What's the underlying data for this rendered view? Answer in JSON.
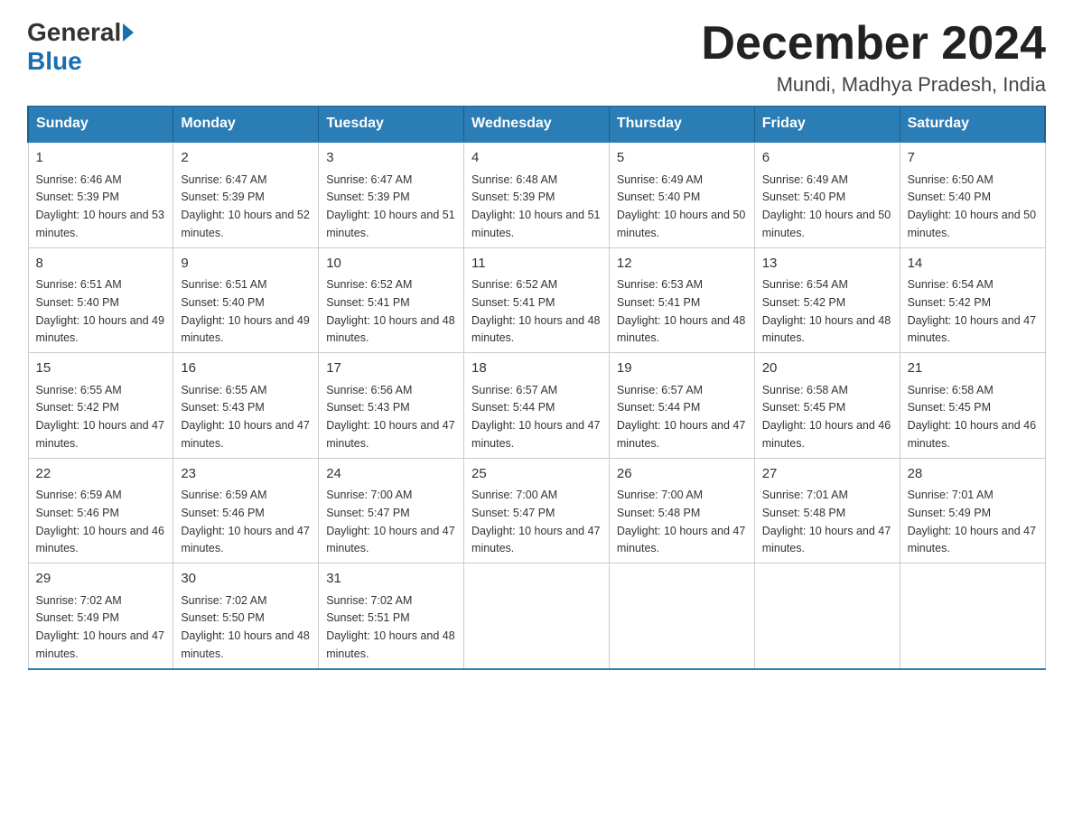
{
  "header": {
    "logo": {
      "general": "General",
      "blue": "Blue"
    },
    "title": "December 2024",
    "location": "Mundi, Madhya Pradesh, India"
  },
  "days_of_week": [
    "Sunday",
    "Monday",
    "Tuesday",
    "Wednesday",
    "Thursday",
    "Friday",
    "Saturday"
  ],
  "weeks": [
    [
      {
        "day": "1",
        "sunrise": "6:46 AM",
        "sunset": "5:39 PM",
        "daylight": "10 hours and 53 minutes."
      },
      {
        "day": "2",
        "sunrise": "6:47 AM",
        "sunset": "5:39 PM",
        "daylight": "10 hours and 52 minutes."
      },
      {
        "day": "3",
        "sunrise": "6:47 AM",
        "sunset": "5:39 PM",
        "daylight": "10 hours and 51 minutes."
      },
      {
        "day": "4",
        "sunrise": "6:48 AM",
        "sunset": "5:39 PM",
        "daylight": "10 hours and 51 minutes."
      },
      {
        "day": "5",
        "sunrise": "6:49 AM",
        "sunset": "5:40 PM",
        "daylight": "10 hours and 50 minutes."
      },
      {
        "day": "6",
        "sunrise": "6:49 AM",
        "sunset": "5:40 PM",
        "daylight": "10 hours and 50 minutes."
      },
      {
        "day": "7",
        "sunrise": "6:50 AM",
        "sunset": "5:40 PM",
        "daylight": "10 hours and 50 minutes."
      }
    ],
    [
      {
        "day": "8",
        "sunrise": "6:51 AM",
        "sunset": "5:40 PM",
        "daylight": "10 hours and 49 minutes."
      },
      {
        "day": "9",
        "sunrise": "6:51 AM",
        "sunset": "5:40 PM",
        "daylight": "10 hours and 49 minutes."
      },
      {
        "day": "10",
        "sunrise": "6:52 AM",
        "sunset": "5:41 PM",
        "daylight": "10 hours and 48 minutes."
      },
      {
        "day": "11",
        "sunrise": "6:52 AM",
        "sunset": "5:41 PM",
        "daylight": "10 hours and 48 minutes."
      },
      {
        "day": "12",
        "sunrise": "6:53 AM",
        "sunset": "5:41 PM",
        "daylight": "10 hours and 48 minutes."
      },
      {
        "day": "13",
        "sunrise": "6:54 AM",
        "sunset": "5:42 PM",
        "daylight": "10 hours and 48 minutes."
      },
      {
        "day": "14",
        "sunrise": "6:54 AM",
        "sunset": "5:42 PM",
        "daylight": "10 hours and 47 minutes."
      }
    ],
    [
      {
        "day": "15",
        "sunrise": "6:55 AM",
        "sunset": "5:42 PM",
        "daylight": "10 hours and 47 minutes."
      },
      {
        "day": "16",
        "sunrise": "6:55 AM",
        "sunset": "5:43 PM",
        "daylight": "10 hours and 47 minutes."
      },
      {
        "day": "17",
        "sunrise": "6:56 AM",
        "sunset": "5:43 PM",
        "daylight": "10 hours and 47 minutes."
      },
      {
        "day": "18",
        "sunrise": "6:57 AM",
        "sunset": "5:44 PM",
        "daylight": "10 hours and 47 minutes."
      },
      {
        "day": "19",
        "sunrise": "6:57 AM",
        "sunset": "5:44 PM",
        "daylight": "10 hours and 47 minutes."
      },
      {
        "day": "20",
        "sunrise": "6:58 AM",
        "sunset": "5:45 PM",
        "daylight": "10 hours and 46 minutes."
      },
      {
        "day": "21",
        "sunrise": "6:58 AM",
        "sunset": "5:45 PM",
        "daylight": "10 hours and 46 minutes."
      }
    ],
    [
      {
        "day": "22",
        "sunrise": "6:59 AM",
        "sunset": "5:46 PM",
        "daylight": "10 hours and 46 minutes."
      },
      {
        "day": "23",
        "sunrise": "6:59 AM",
        "sunset": "5:46 PM",
        "daylight": "10 hours and 47 minutes."
      },
      {
        "day": "24",
        "sunrise": "7:00 AM",
        "sunset": "5:47 PM",
        "daylight": "10 hours and 47 minutes."
      },
      {
        "day": "25",
        "sunrise": "7:00 AM",
        "sunset": "5:47 PM",
        "daylight": "10 hours and 47 minutes."
      },
      {
        "day": "26",
        "sunrise": "7:00 AM",
        "sunset": "5:48 PM",
        "daylight": "10 hours and 47 minutes."
      },
      {
        "day": "27",
        "sunrise": "7:01 AM",
        "sunset": "5:48 PM",
        "daylight": "10 hours and 47 minutes."
      },
      {
        "day": "28",
        "sunrise": "7:01 AM",
        "sunset": "5:49 PM",
        "daylight": "10 hours and 47 minutes."
      }
    ],
    [
      {
        "day": "29",
        "sunrise": "7:02 AM",
        "sunset": "5:49 PM",
        "daylight": "10 hours and 47 minutes."
      },
      {
        "day": "30",
        "sunrise": "7:02 AM",
        "sunset": "5:50 PM",
        "daylight": "10 hours and 48 minutes."
      },
      {
        "day": "31",
        "sunrise": "7:02 AM",
        "sunset": "5:51 PM",
        "daylight": "10 hours and 48 minutes."
      },
      null,
      null,
      null,
      null
    ]
  ]
}
